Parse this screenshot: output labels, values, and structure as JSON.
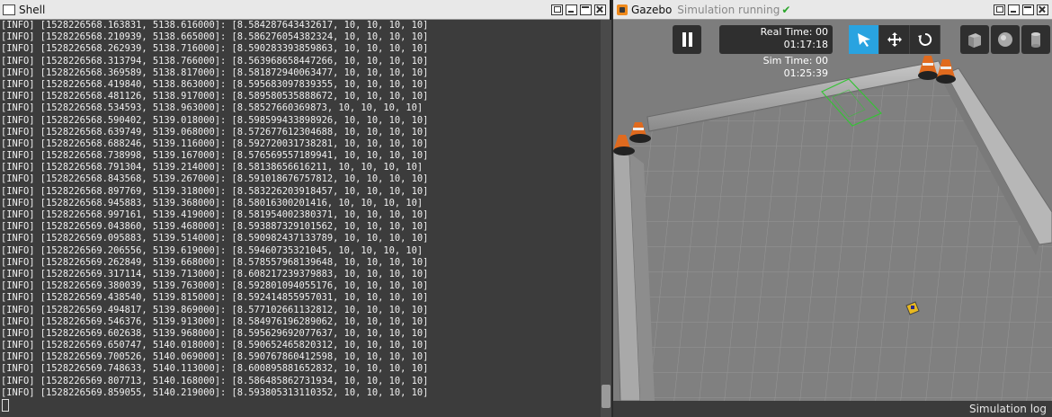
{
  "shell": {
    "title": "Shell",
    "lines": [
      "[INFO] [1528226568.163831, 5138.616000]: [8.584287643432617, 10, 10, 10, 10]",
      "[INFO] [1528226568.210939, 5138.665000]: [8.586276054382324, 10, 10, 10, 10]",
      "[INFO] [1528226568.262939, 5138.716000]: [8.590283393859863, 10, 10, 10, 10]",
      "[INFO] [1528226568.313794, 5138.766000]: [8.563968658447266, 10, 10, 10, 10]",
      "[INFO] [1528226568.369589, 5138.817000]: [8.581872940063477, 10, 10, 10, 10]",
      "[INFO] [1528226568.419840, 5138.863000]: [8.595683097839355, 10, 10, 10, 10]",
      "[INFO] [1528226568.481126, 5138.917000]: [8.589580535888672, 10, 10, 10, 10]",
      "[INFO] [1528226568.534593, 5138.963000]: [8.58527660369873, 10, 10, 10, 10]",
      "[INFO] [1528226568.590402, 5139.018000]: [8.598599433898926, 10, 10, 10, 10]",
      "[INFO] [1528226568.639749, 5139.068000]: [8.572677612304688, 10, 10, 10, 10]",
      "[INFO] [1528226568.688246, 5139.116000]: [8.592720031738281, 10, 10, 10, 10]",
      "[INFO] [1528226568.738998, 5139.167000]: [8.576569557189941, 10, 10, 10, 10]",
      "[INFO] [1528226568.791304, 5139.214000]: [8.58138656616211, 10, 10, 10, 10]",
      "[INFO] [1528226568.843568, 5139.267000]: [8.591018676757812, 10, 10, 10, 10]",
      "[INFO] [1528226568.897769, 5139.318000]: [8.583226203918457, 10, 10, 10, 10]",
      "[INFO] [1528226568.945883, 5139.368000]: [8.58016300201416, 10, 10, 10, 10]",
      "[INFO] [1528226568.997161, 5139.419000]: [8.581954002380371, 10, 10, 10, 10]",
      "[INFO] [1528226569.043860, 5139.468000]: [8.593887329101562, 10, 10, 10, 10]",
      "[INFO] [1528226569.095883, 5139.514000]: [8.590982437133789, 10, 10, 10, 10]",
      "[INFO] [1528226569.206556, 5139.619000]: [8.59460735321045, 10, 10, 10, 10]",
      "[INFO] [1528226569.262849, 5139.668000]: [8.578557968139648, 10, 10, 10, 10]",
      "[INFO] [1528226569.317114, 5139.713000]: [8.608217239379883, 10, 10, 10, 10]",
      "[INFO] [1528226569.380039, 5139.763000]: [8.592801094055176, 10, 10, 10, 10]",
      "[INFO] [1528226569.438540, 5139.815000]: [8.592414855957031, 10, 10, 10, 10]",
      "[INFO] [1528226569.494817, 5139.869000]: [8.577102661132812, 10, 10, 10, 10]",
      "[INFO] [1528226569.546376, 5139.913000]: [8.584976196289062, 10, 10, 10, 10]",
      "[INFO] [1528226569.602638, 5139.968000]: [8.595629692077637, 10, 10, 10, 10]",
      "[INFO] [1528226569.650747, 5140.018000]: [8.590652465820312, 10, 10, 10, 10]",
      "[INFO] [1528226569.700526, 5140.069000]: [8.590767860412598, 10, 10, 10, 10]",
      "[INFO] [1528226569.748633, 5140.113000]: [8.600895881652832, 10, 10, 10, 10]",
      "[INFO] [1528226569.807713, 5140.168000]: [8.586485862731934, 10, 10, 10, 10]",
      "[INFO] [1528226569.859055, 5140.219000]: [8.593805313110352, 10, 10, 10, 10]"
    ]
  },
  "gazebo": {
    "title": "Gazebo",
    "status": "Simulation running",
    "real_time_label": "Real Time: 00",
    "real_time_value": "01:17:18",
    "sim_time_label": "Sim Time: 00",
    "sim_time_value": "01:25:39",
    "sim_log_label": "Simulation log"
  },
  "colors": {
    "accent": "#29a3e0",
    "running": "#2aa52a",
    "cone": "#e06a1e"
  }
}
